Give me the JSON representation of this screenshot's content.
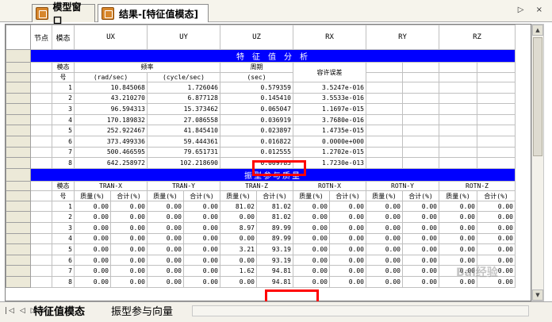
{
  "tabs": {
    "model": "模型窗口",
    "result": "结果-[特征值模态]"
  },
  "header": {
    "node": "节点",
    "mode": "模态",
    "cols": [
      "UX",
      "UY",
      "UZ",
      "RX",
      "RY",
      "RZ"
    ]
  },
  "eig_band": "特 征 值 分 析",
  "eig_hdr": {
    "mode": "模态",
    "mode2": "号",
    "freq": "频率",
    "rad": "(rad/sec)",
    "cyc": "(cycle/sec)",
    "period": "周期",
    "sec": "(sec)",
    "tol": "容许误差"
  },
  "eig_rows": [
    [
      "1",
      "10.845068",
      "1.726046",
      "0.579359",
      "3.5247e-016"
    ],
    [
      "2",
      "43.210270",
      "6.877128",
      "0.145410",
      "3.5533e-016"
    ],
    [
      "3",
      "96.594313",
      "15.373462",
      "0.065047",
      "1.1697e-015"
    ],
    [
      "4",
      "170.189832",
      "27.086558",
      "0.036919",
      "3.7680e-016"
    ],
    [
      "5",
      "252.922467",
      "41.845410",
      "0.023897",
      "1.4735e-015"
    ],
    [
      "6",
      "373.499336",
      "59.444361",
      "0.016822",
      "0.0000e+000"
    ],
    [
      "7",
      "500.466595",
      "79.651731",
      "0.012555",
      "1.2702e-015"
    ],
    [
      "8",
      "642.258972",
      "102.218690",
      "0.009783",
      "1.7230e-013"
    ]
  ],
  "mass_band": "振型参与质量",
  "mass_hdr": {
    "mode": "模态",
    "mode2": "号",
    "groups": [
      "TRAN-X",
      "TRAN-Y",
      "TRAN-Z",
      "ROTN-X",
      "ROTN-Y",
      "ROTN-Z"
    ],
    "mass": "质量(%)",
    "sum": "合计(%)"
  },
  "mass_rows": [
    [
      "1",
      "0.00",
      "0.00",
      "0.00",
      "0.00",
      "81.02",
      "81.02",
      "0.00",
      "0.00",
      "0.00",
      "0.00",
      "0.00",
      "0.00"
    ],
    [
      "2",
      "0.00",
      "0.00",
      "0.00",
      "0.00",
      "0.00",
      "81.02",
      "0.00",
      "0.00",
      "0.00",
      "0.00",
      "0.00",
      "0.00"
    ],
    [
      "3",
      "0.00",
      "0.00",
      "0.00",
      "0.00",
      "8.97",
      "89.99",
      "0.00",
      "0.00",
      "0.00",
      "0.00",
      "0.00",
      "0.00"
    ],
    [
      "4",
      "0.00",
      "0.00",
      "0.00",
      "0.00",
      "0.00",
      "89.99",
      "0.00",
      "0.00",
      "0.00",
      "0.00",
      "0.00",
      "0.00"
    ],
    [
      "5",
      "0.00",
      "0.00",
      "0.00",
      "0.00",
      "3.21",
      "93.19",
      "0.00",
      "0.00",
      "0.00",
      "0.00",
      "0.00",
      "0.00"
    ],
    [
      "6",
      "0.00",
      "0.00",
      "0.00",
      "0.00",
      "0.00",
      "93.19",
      "0.00",
      "0.00",
      "0.00",
      "0.00",
      "0.00",
      "0.00"
    ],
    [
      "7",
      "0.00",
      "0.00",
      "0.00",
      "0.00",
      "1.62",
      "94.81",
      "0.00",
      "0.00",
      "0.00",
      "0.00",
      "0.00",
      "0.00"
    ],
    [
      "8",
      "0.00",
      "0.00",
      "0.00",
      "0.00",
      "0.00",
      "94.81",
      "0.00",
      "0.00",
      "0.00",
      "0.00",
      "0.00",
      "0.00"
    ]
  ],
  "bottom_tabs": {
    "eig": "特征值模态",
    "vec": "振型参与向量"
  },
  "watermark": "Bai经验"
}
